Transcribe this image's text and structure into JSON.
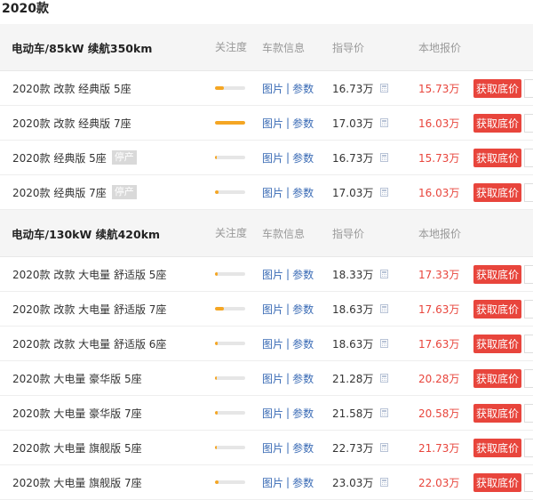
{
  "year_title": "2020款",
  "headers": {
    "attention": "关注度",
    "info": "车款信息",
    "guide_price": "指导价",
    "local_price": "本地报价"
  },
  "links": {
    "image": "图片",
    "separator": "|",
    "params": "参数"
  },
  "button_label": "获取底价",
  "stop_label": "停产",
  "colors": {
    "accent": "#e8453c",
    "link": "#3a6bb5",
    "bar": "#f5a623",
    "header_bg": "#f5f5f5"
  },
  "groups": [
    {
      "name": "电动车/85kW 续航350km",
      "rows": [
        {
          "name": "2020款 改款 经典版 5座",
          "stopped": false,
          "attention": 0.3,
          "guide": "16.73万",
          "local": "15.73万"
        },
        {
          "name": "2020款 改款 经典版 7座",
          "stopped": false,
          "attention": 1.0,
          "guide": "17.03万",
          "local": "16.03万"
        },
        {
          "name": "2020款 经典版 5座",
          "stopped": true,
          "attention": 0.04,
          "guide": "16.73万",
          "local": "15.73万"
        },
        {
          "name": "2020款 经典版 7座",
          "stopped": true,
          "attention": 0.12,
          "guide": "17.03万",
          "local": "16.03万"
        }
      ]
    },
    {
      "name": "电动车/130kW 续航420km",
      "rows": [
        {
          "name": "2020款 改款 大电量 舒适版 5座",
          "stopped": false,
          "attention": 0.1,
          "guide": "18.33万",
          "local": "17.33万"
        },
        {
          "name": "2020款 改款 大电量 舒适版 7座",
          "stopped": false,
          "attention": 0.3,
          "guide": "18.63万",
          "local": "17.63万"
        },
        {
          "name": "2020款 改款 大电量 舒适版 6座",
          "stopped": false,
          "attention": 0.1,
          "guide": "18.63万",
          "local": "17.63万"
        },
        {
          "name": "2020款 大电量 豪华版 5座",
          "stopped": false,
          "attention": 0.04,
          "guide": "21.28万",
          "local": "20.28万"
        },
        {
          "name": "2020款 大电量 豪华版 7座",
          "stopped": false,
          "attention": 0.1,
          "guide": "21.58万",
          "local": "20.58万"
        },
        {
          "name": "2020款 大电量 旗舰版 5座",
          "stopped": false,
          "attention": 0.04,
          "guide": "22.73万",
          "local": "21.73万"
        },
        {
          "name": "2020款 大电量 旗舰版 7座",
          "stopped": false,
          "attention": 0.12,
          "guide": "23.03万",
          "local": "22.03万"
        }
      ]
    }
  ]
}
